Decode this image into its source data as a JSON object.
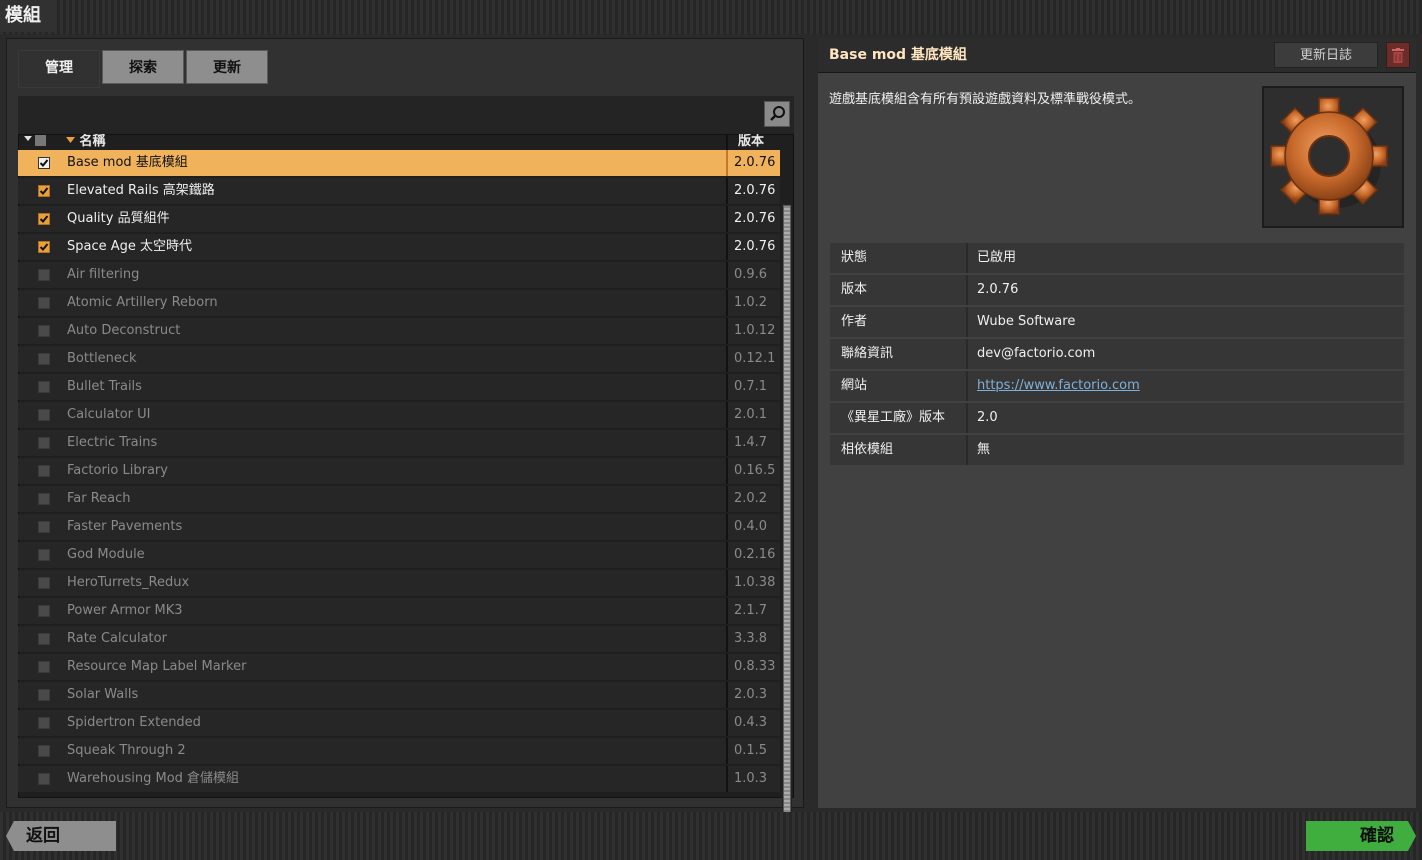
{
  "window": {
    "title": "模組"
  },
  "tabs": [
    {
      "label": "管理",
      "active": true
    },
    {
      "label": "探索",
      "active": false
    },
    {
      "label": "更新",
      "active": false
    }
  ],
  "search": {
    "placeholder": "",
    "icon": "search-icon"
  },
  "list_header": {
    "name": "名稱",
    "version": "版本"
  },
  "mods": [
    {
      "name": "Base mod 基底模組",
      "version": "2.0.76",
      "enabled": true,
      "selected": true
    },
    {
      "name": "Elevated Rails 高架鐵路",
      "version": "2.0.76",
      "enabled": true
    },
    {
      "name": "Quality 品質組件",
      "version": "2.0.76",
      "enabled": true
    },
    {
      "name": "Space Age 太空時代",
      "version": "2.0.76",
      "enabled": true
    },
    {
      "name": "Air filtering",
      "version": "0.9.6",
      "enabled": false
    },
    {
      "name": "Atomic Artillery Reborn",
      "version": "1.0.2",
      "enabled": false
    },
    {
      "name": "Auto Deconstruct",
      "version": "1.0.12",
      "enabled": false
    },
    {
      "name": "Bottleneck",
      "version": "0.12.1",
      "enabled": false
    },
    {
      "name": "Bullet Trails",
      "version": "0.7.1",
      "enabled": false
    },
    {
      "name": "Calculator UI",
      "version": "2.0.1",
      "enabled": false
    },
    {
      "name": "Electric Trains",
      "version": "1.4.7",
      "enabled": false
    },
    {
      "name": "Factorio Library",
      "version": "0.16.5",
      "enabled": false
    },
    {
      "name": "Far Reach",
      "version": "2.0.2",
      "enabled": false
    },
    {
      "name": "Faster Pavements",
      "version": "0.4.0",
      "enabled": false
    },
    {
      "name": "God Module",
      "version": "0.2.16",
      "enabled": false
    },
    {
      "name": "HeroTurrets_Redux",
      "version": "1.0.38",
      "enabled": false
    },
    {
      "name": "Power Armor MK3",
      "version": "2.1.7",
      "enabled": false
    },
    {
      "name": "Rate Calculator",
      "version": "3.3.8",
      "enabled": false
    },
    {
      "name": "Resource Map Label Marker",
      "version": "0.8.33",
      "enabled": false
    },
    {
      "name": "Solar Walls",
      "version": "2.0.3",
      "enabled": false
    },
    {
      "name": "Spidertron Extended",
      "version": "0.4.3",
      "enabled": false
    },
    {
      "name": "Squeak Through 2",
      "version": "0.1.5",
      "enabled": false
    },
    {
      "name": "Warehousing Mod 倉儲模組",
      "version": "1.0.3",
      "enabled": false
    }
  ],
  "detail": {
    "title": "Base mod 基底模組",
    "changelog_label": "更新日誌",
    "delete_icon": "trash-icon",
    "description": "遊戲基底模組含有所有預設遊戲資料及標準戰役模式。",
    "thumbnail_icon": "gear-icon",
    "info": [
      {
        "key": "狀態",
        "value": "已啟用"
      },
      {
        "key": "版本",
        "value": "2.0.76"
      },
      {
        "key": "作者",
        "value": "Wube Software"
      },
      {
        "key": "聯絡資訊",
        "value": "dev@factorio.com"
      },
      {
        "key": "網站",
        "value": "https://www.factorio.com",
        "link": true
      },
      {
        "key": "《異星工廠》版本",
        "value": "2.0"
      },
      {
        "key": "相依模組",
        "value": "無"
      }
    ]
  },
  "footer": {
    "back_label": "返回",
    "confirm_label": "確認"
  },
  "colors": {
    "accent_orange": "#f0b35c",
    "checkbox_orange": "#e8a13a",
    "confirm_green": "#3fae3f",
    "delete_red": "#6a2d2a",
    "link_blue": "#7fb0d8"
  }
}
